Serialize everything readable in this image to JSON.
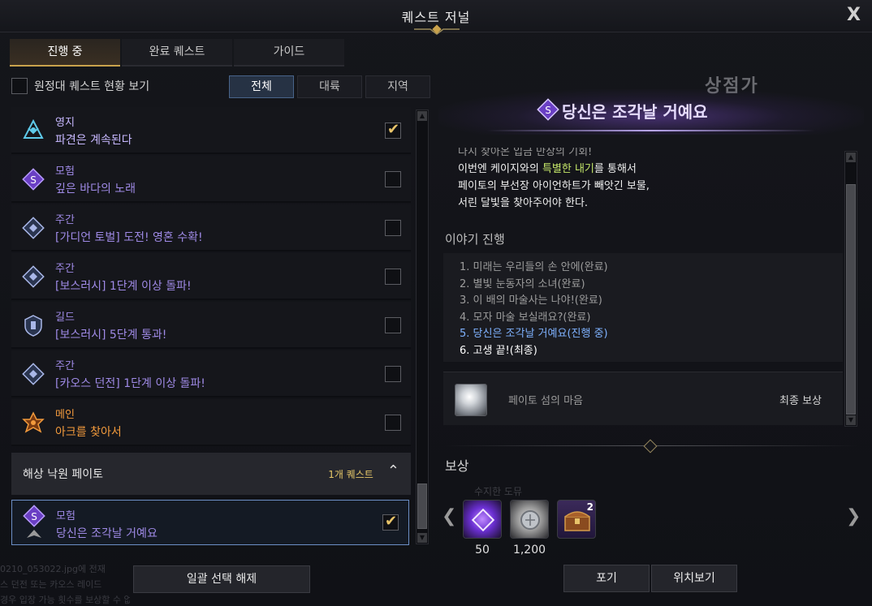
{
  "window": {
    "title": "퀘스트 저널",
    "close_label": "X"
  },
  "tabs": [
    {
      "label": "진행 중",
      "active": true
    },
    {
      "label": "완료 퀘스트",
      "active": false
    },
    {
      "label": "가이드",
      "active": false
    }
  ],
  "filters": {
    "expedition_label": "원정대 퀘스트 현황 보기",
    "buttons": [
      "전체",
      "대륙",
      "지역"
    ],
    "active": "전체"
  },
  "quests": [
    {
      "category": "영지",
      "name": "파견은 계속된다",
      "icon": "estate-icon",
      "checked": true
    },
    {
      "category": "모험",
      "name": "깊은 바다의 노래",
      "icon": "adventure-icon",
      "checked": false
    },
    {
      "category": "주간",
      "name": "[가디언 토벌] 도전! 영혼 수확!",
      "icon": "weekly-icon",
      "checked": false
    },
    {
      "category": "주간",
      "name": "[보스러시] 1단계 이상 돌파!",
      "icon": "weekly-icon",
      "checked": false
    },
    {
      "category": "길드",
      "name": "[보스러시] 5단계 통과!",
      "icon": "guild-icon",
      "checked": false
    },
    {
      "category": "주간",
      "name": "[카오스 던전] 1단계 이상 돌파!",
      "icon": "weekly-icon",
      "checked": false
    },
    {
      "category": "메인",
      "name": "아크를 찾아서",
      "icon": "main-quest-icon",
      "checked": false
    }
  ],
  "region_group": {
    "name": "해상 낙원 페이토",
    "count": "1개 퀘스트"
  },
  "selected_quest": {
    "category": "모험",
    "name": "당신은 조각날 거예요",
    "checked": true
  },
  "background_text": [
    "0210_053022.jpg에 전재",
    "스 던전 또는 카오스 레이드",
    "경우 입장 가능 횟수를 보상할 수 없어요"
  ],
  "deselect_label": "일괄 선택 해제",
  "detail": {
    "zone": "상점가",
    "title": "당신은 조각날 거예요",
    "story": {
      "line0": "다시 찾아온 입금 만장의 기회!",
      "line1_pre": "이번엔 케이지와의 ",
      "line1_hl": "특별한 내기",
      "line1_post": "를 통해서",
      "line2": "페이토의 부선장 아이언하트가 빼앗긴 보물,",
      "line3": "서린 달빛을 찾아주어야 한다."
    },
    "progress_header": "이야기 진행",
    "steps": [
      "1. 미래는 우리들의 손 안에(완료)",
      "2. 별빛 눈동자의 소녀(완료)",
      "3. 이 배의 마술사는 나야!(완료)",
      "4. 모자 마술 보실래요?(완료)",
      "5. 당신은 조각날 거예요(진행 중)",
      "6. 고생 끝!(최종)"
    ],
    "final_reward": {
      "name": "페이토 섬의 마음",
      "tag": "최종 보상"
    }
  },
  "rewards": {
    "header": "보상",
    "ghost_label": "수지한 도뮤",
    "items": [
      {
        "icon": "purple-crystal-icon",
        "count": "50"
      },
      {
        "icon": "silver-coin-icon",
        "count": "1,200"
      },
      {
        "icon": "treasure-chest-icon",
        "count": "",
        "badge": "2"
      }
    ]
  },
  "actions": {
    "abandon": "포기",
    "locate": "위치보기"
  },
  "colors": {
    "accent_gold": "#c9a24c",
    "quest_purple": "#9f8ae6",
    "main_orange": "#f29a3c",
    "current_step_blue": "#7fb2ff",
    "highlight_green": "#c6e86a"
  }
}
